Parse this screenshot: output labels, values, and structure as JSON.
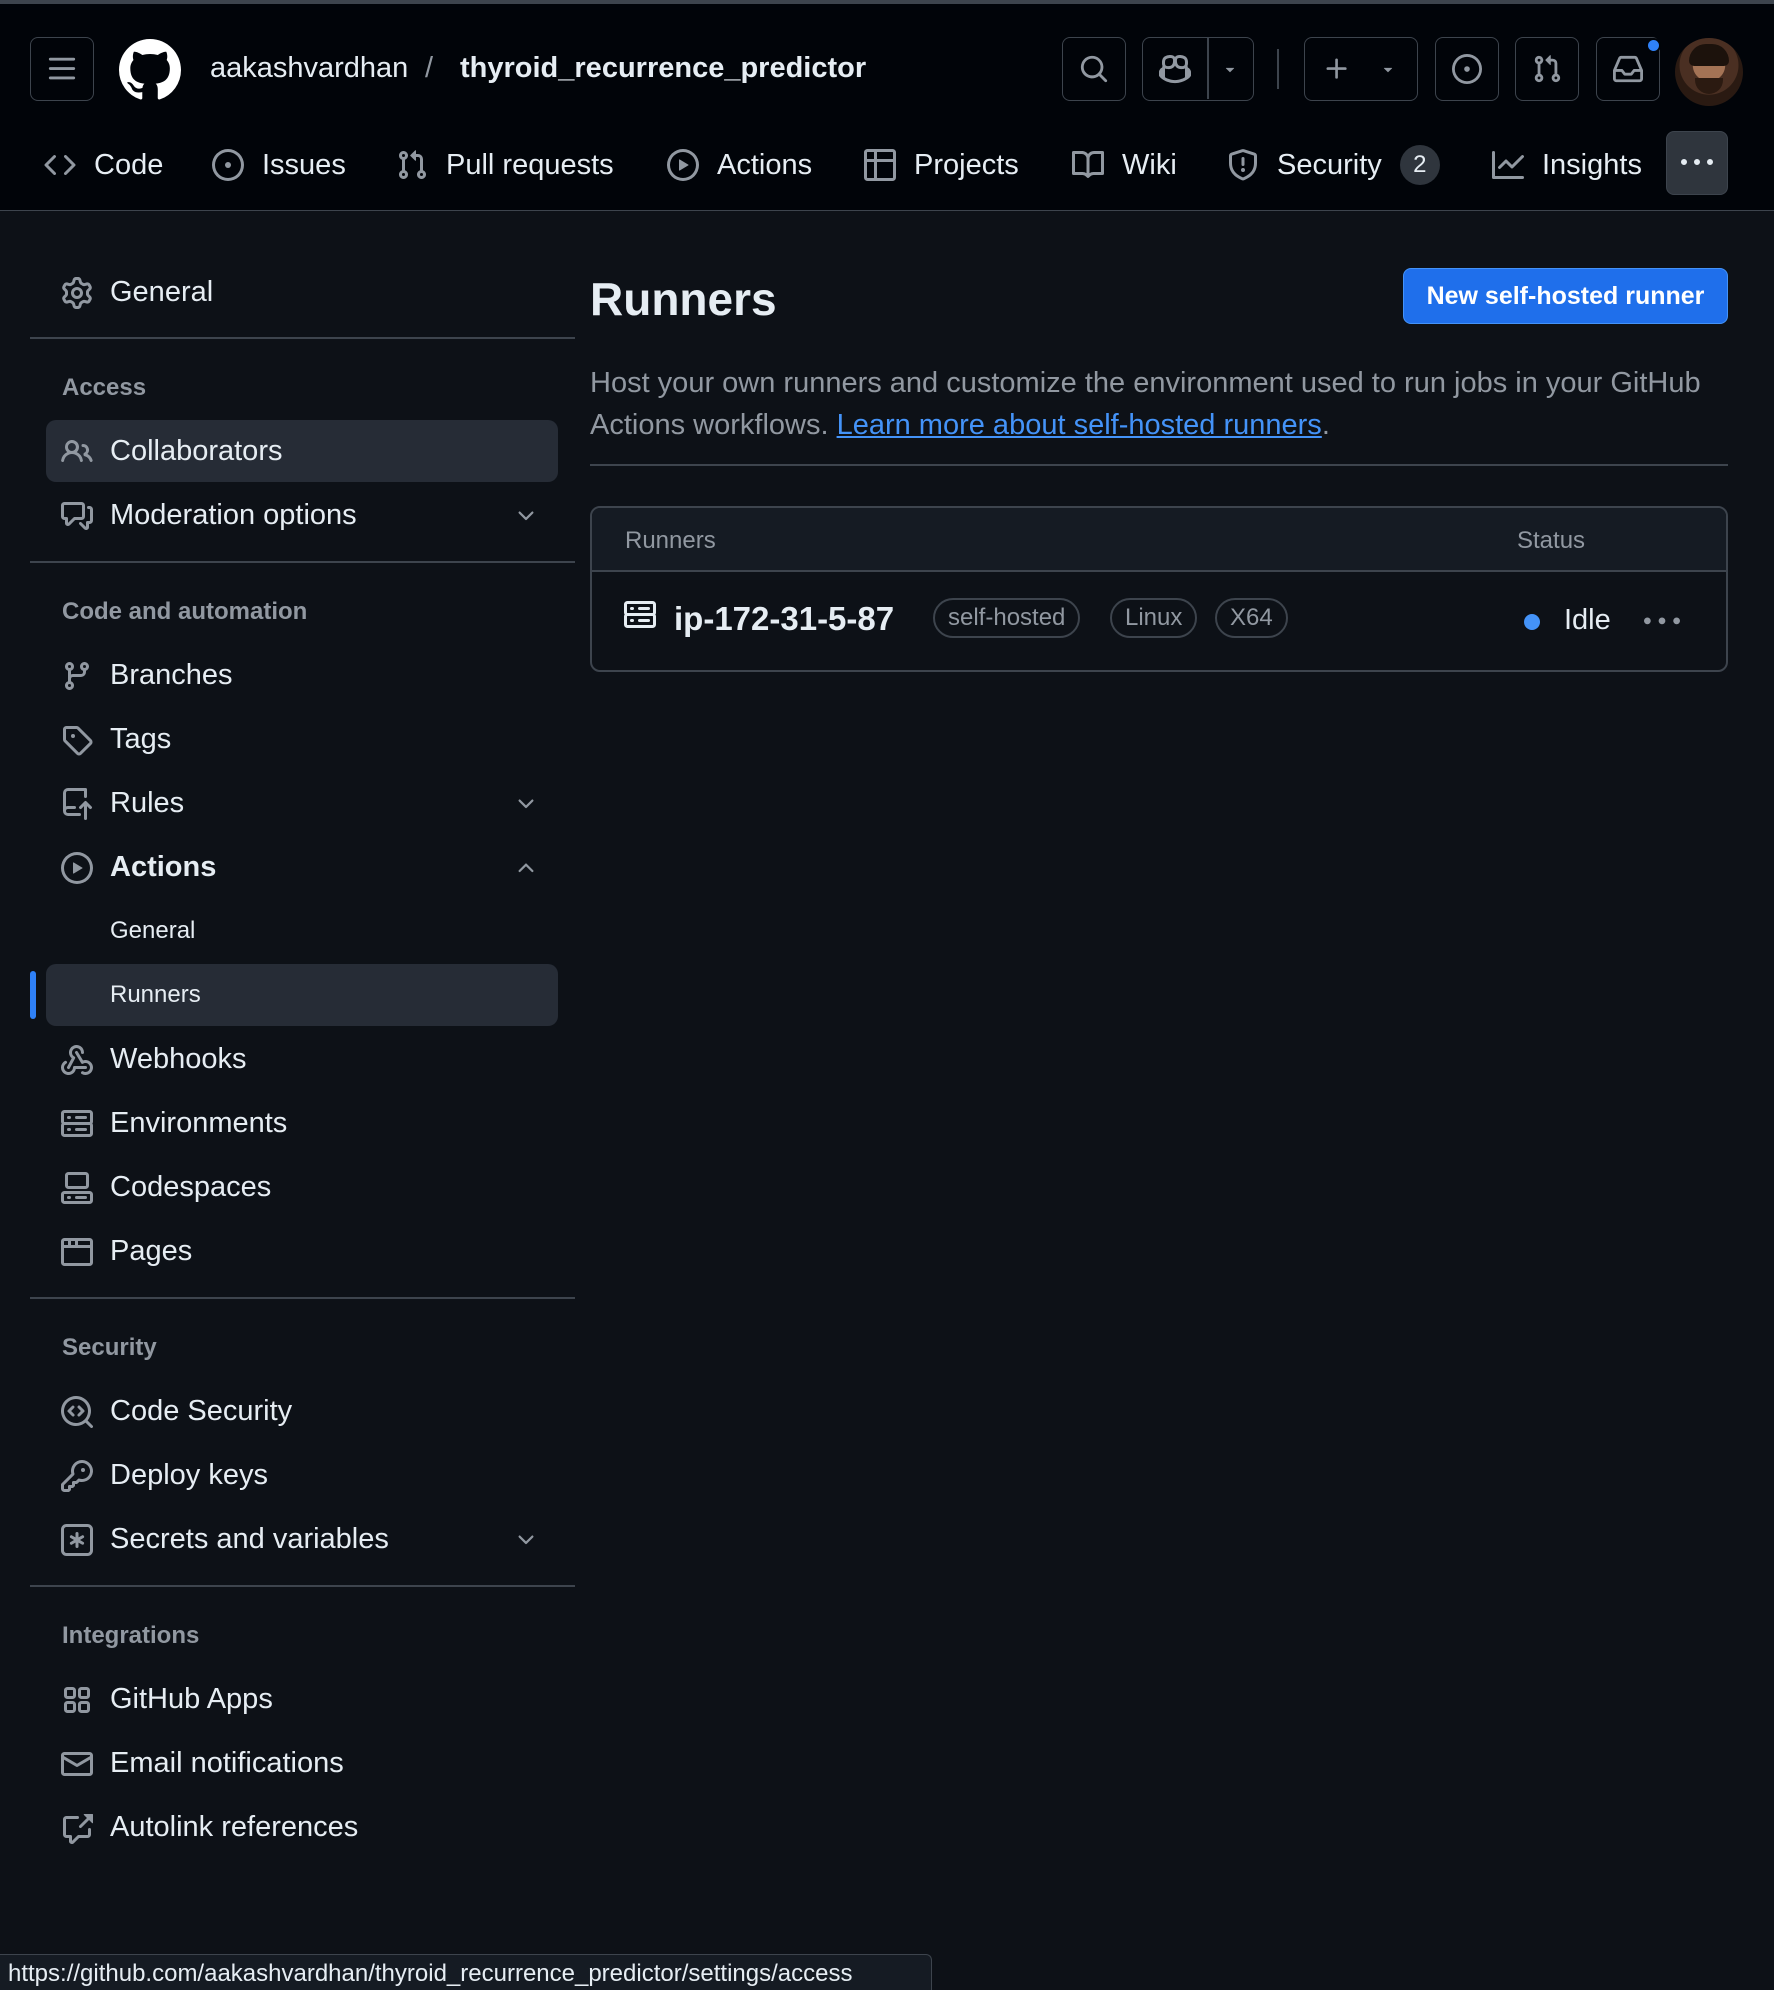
{
  "header": {
    "owner": "aakashvardhan",
    "separator": "/",
    "repo": "thyroid_recurrence_predictor"
  },
  "tabs": [
    {
      "label": "Code",
      "icon": "code-icon"
    },
    {
      "label": "Issues",
      "icon": "issue-opened-icon"
    },
    {
      "label": "Pull requests",
      "icon": "git-pull-request-icon"
    },
    {
      "label": "Actions",
      "icon": "play-icon"
    },
    {
      "label": "Projects",
      "icon": "table-icon"
    },
    {
      "label": "Wiki",
      "icon": "book-icon"
    },
    {
      "label": "Security",
      "icon": "shield-icon",
      "count": "2"
    },
    {
      "label": "Insights",
      "icon": "graph-icon"
    }
  ],
  "sidebar": {
    "general": "General",
    "access_heading": "Access",
    "collaborators": "Collaborators",
    "moderation": "Moderation options",
    "code_automation_heading": "Code and automation",
    "branches": "Branches",
    "tags": "Tags",
    "rules": "Rules",
    "actions": "Actions",
    "actions_general": "General",
    "actions_runners": "Runners",
    "webhooks": "Webhooks",
    "environments": "Environments",
    "codespaces": "Codespaces",
    "pages": "Pages",
    "security_heading": "Security",
    "code_security": "Code Security",
    "deploy_keys": "Deploy keys",
    "secrets": "Secrets and variables",
    "integrations_heading": "Integrations",
    "github_apps": "GitHub Apps",
    "email_notifications": "Email notifications",
    "autolink": "Autolink references"
  },
  "main": {
    "title": "Runners",
    "new_runner_button": "New self-hosted runner",
    "description_prefix": "Host your own runners and customize the environment used to run jobs in your GitHub Actions workflows.",
    "description_link": "Learn more about self-hosted runners",
    "description_suffix": ".",
    "table": {
      "col_runners": "Runners",
      "col_status": "Status",
      "rows": [
        {
          "name": "ip-172-31-5-87",
          "labels": [
            "self-hosted",
            "Linux",
            "X64"
          ],
          "status": "Idle",
          "status_color": "#4493f8"
        }
      ]
    }
  },
  "statusbar": {
    "url": "https://github.com/aakashvardhan/thyroid_recurrence_predictor/settings/access"
  },
  "colors": {
    "background": "#0d1117",
    "header": "#010409",
    "accent": "#1f6feb",
    "link": "#4493f8",
    "border": "#3d444d"
  }
}
